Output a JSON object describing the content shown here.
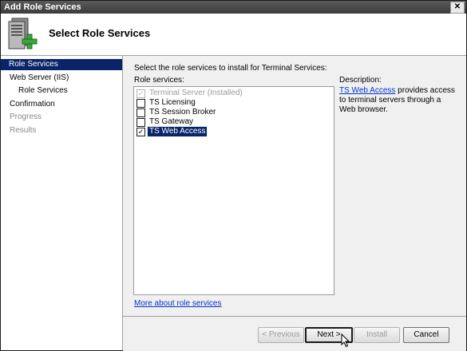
{
  "window": {
    "title": "Add Role Services",
    "close_glyph": "✕"
  },
  "header": {
    "title": "Select Role Services",
    "icon": "server-roles-icon"
  },
  "sidebar": {
    "items": [
      {
        "label": "Role Services",
        "state": "active"
      },
      {
        "label": "Web Server (IIS)",
        "state": "normal"
      },
      {
        "label": "Role Services",
        "state": "normal"
      },
      {
        "label": "Confirmation",
        "state": "normal"
      },
      {
        "label": "Progress",
        "state": "disabled"
      },
      {
        "label": "Results",
        "state": "disabled"
      }
    ]
  },
  "main": {
    "instruction": "Select the role services to install for Terminal Services:",
    "role_services_label": "Role services:",
    "role_services": [
      {
        "label": "Terminal Server  (Installed)",
        "checked": true,
        "disabled": true,
        "selected": false
      },
      {
        "label": "TS Licensing",
        "checked": false,
        "disabled": false,
        "selected": false
      },
      {
        "label": "TS Session Broker",
        "checked": false,
        "disabled": false,
        "selected": false
      },
      {
        "label": "TS Gateway",
        "checked": false,
        "disabled": false,
        "selected": false
      },
      {
        "label": "TS Web Access",
        "checked": true,
        "disabled": false,
        "selected": true
      }
    ],
    "more_link": "More about role services",
    "description": {
      "label": "Description:",
      "link": "TS Web Access",
      "text": " provides access to terminal servers through a Web browser."
    }
  },
  "footer": {
    "previous": "< Previous",
    "next": "Next >",
    "install": "Install",
    "cancel": "Cancel"
  },
  "colors": {
    "selection": "#0a246a",
    "link": "#0033cc"
  }
}
